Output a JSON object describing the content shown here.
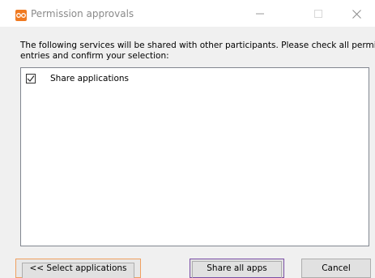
{
  "window": {
    "title": "Permission approvals",
    "icon": "app-logo-icon",
    "controls": {
      "minimize_icon": "minimize-icon",
      "maximize_icon": "maximize-icon",
      "close_icon": "close-icon"
    }
  },
  "description": {
    "line1": "The following services will be shared with other participants. Please check all permitted",
    "line2": "entries and confirm your selection:"
  },
  "services": [
    {
      "label": "Share applications",
      "checked": true
    }
  ],
  "buttons": {
    "select_applications": "<< Select applications",
    "share_all_apps": "Share all apps",
    "cancel": "Cancel"
  },
  "colors": {
    "accent_orange": "#f07a21",
    "focus_purple": "#7b4fa6",
    "focus_orange": "#f0a060",
    "title_gray": "#8a8a8a"
  }
}
